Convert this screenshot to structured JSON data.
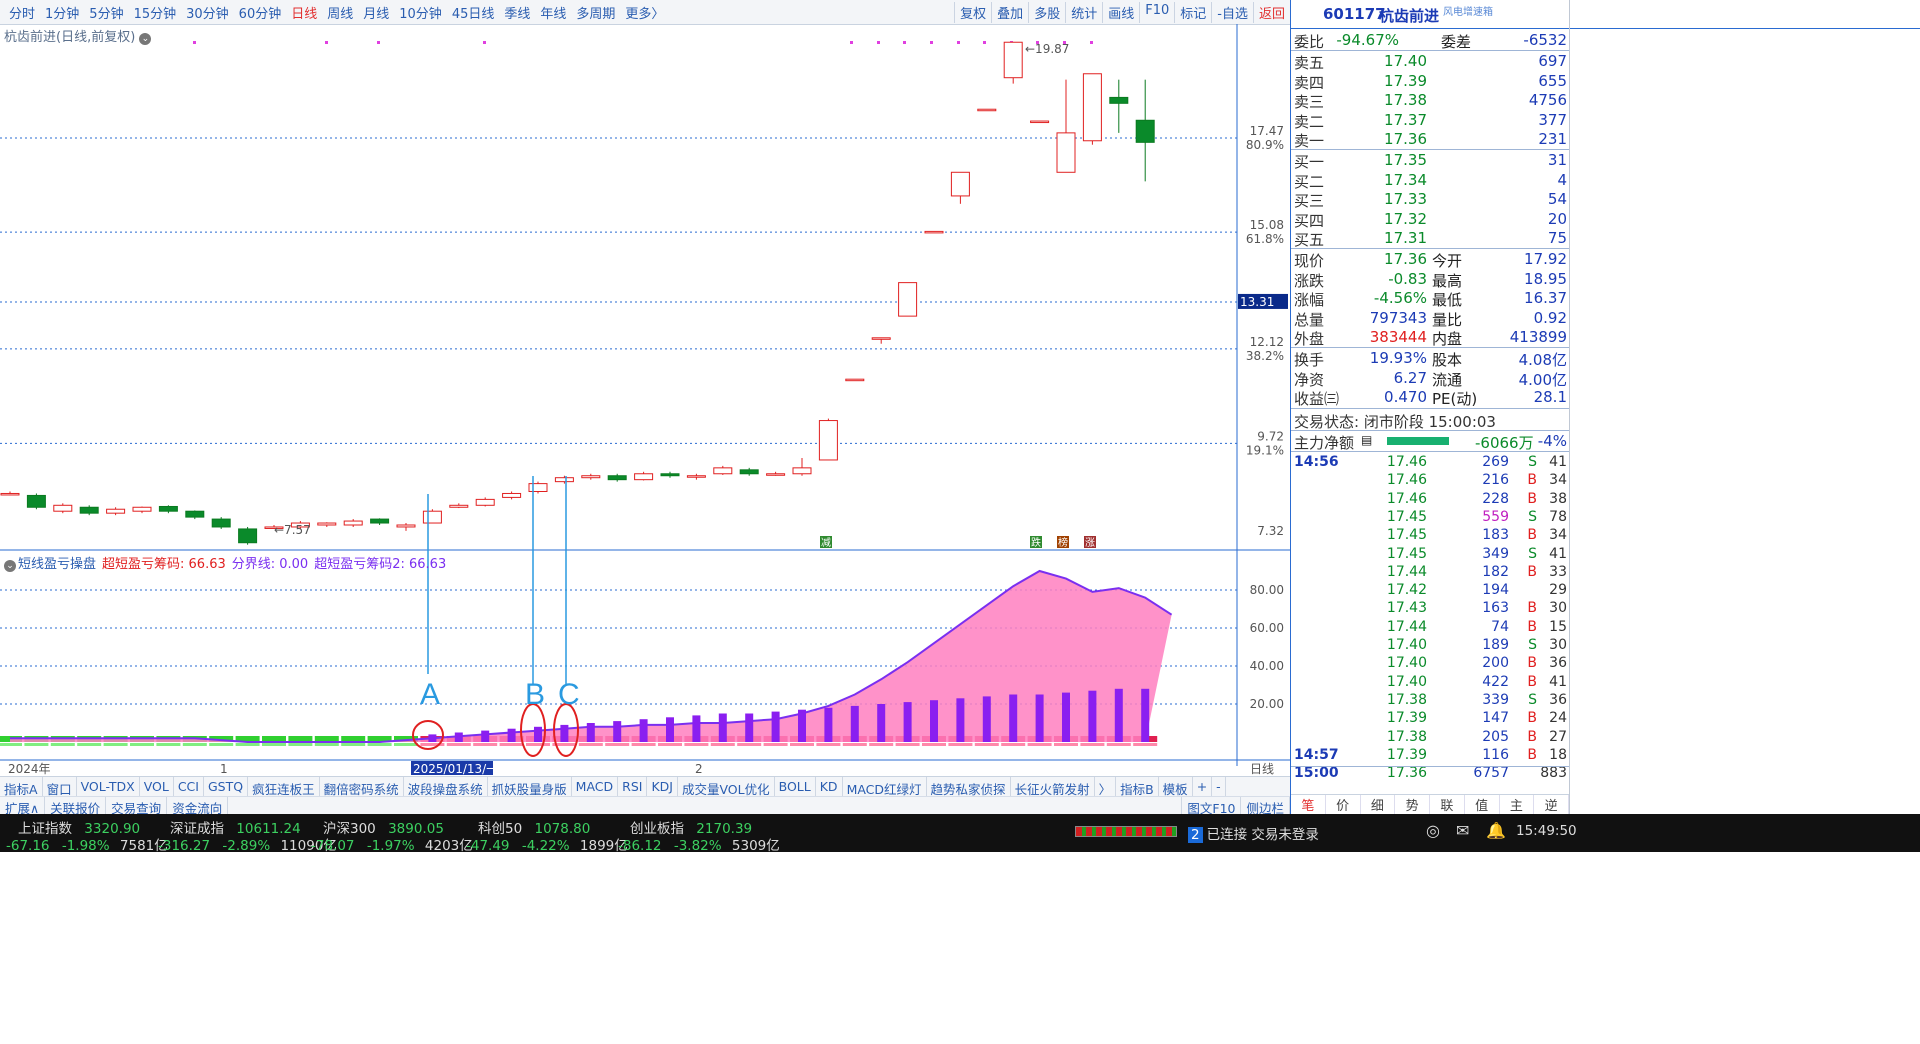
{
  "toolbar": {
    "periods": [
      "分时",
      "1分钟",
      "5分钟",
      "15分钟",
      "30分钟",
      "60分钟",
      "日线",
      "周线",
      "月线",
      "10分钟",
      "45日线",
      "季线",
      "年线",
      "多周期",
      "更多〉"
    ],
    "active_period": "日线",
    "tools": [
      "复权",
      "叠加",
      "多股",
      "统计",
      "画线",
      "F10",
      "标记",
      "-自选",
      "返回"
    ]
  },
  "chart": {
    "title": "杭齿前进(日线,前复权)",
    "price_levels": [
      "17.47",
      "15.08",
      "12.12",
      "9.72",
      "7.32"
    ],
    "pct_levels": [
      "80.9%",
      "61.8%",
      "38.2%",
      "19.1%"
    ],
    "current_marker": "13.31",
    "high_label": "19.87",
    "low_label": "7.57",
    "badges": [
      "减",
      "跌",
      "榜",
      "涨"
    ],
    "date_labels": [
      "2024年",
      "1",
      "2025/01/13/一",
      "2",
      "日线"
    ],
    "annotations": [
      "A",
      "B",
      "C"
    ]
  },
  "indicator": {
    "name": "短线盈亏操盘",
    "line1": "超短盈亏筹码: 66.63",
    "line2": "分界线: 0.00",
    "line3": "超短盈亏筹码2: 66.63",
    "levels": [
      "80.00",
      "60.00",
      "40.00",
      "20.00"
    ]
  },
  "chart_data": {
    "type": "candlestick",
    "title": "杭齿前进(日线,前复权)",
    "candles": [
      {
        "o": 8.45,
        "c": 8.45,
        "h": 8.5,
        "l": 8.4
      },
      {
        "o": 8.4,
        "c": 8.1,
        "h": 8.45,
        "l": 8.05
      },
      {
        "o": 8.0,
        "c": 8.15,
        "h": 8.2,
        "l": 7.95
      },
      {
        "o": 8.1,
        "c": 7.95,
        "h": 8.15,
        "l": 7.9
      },
      {
        "o": 7.95,
        "c": 8.05,
        "h": 8.1,
        "l": 7.9
      },
      {
        "o": 8.0,
        "c": 8.1,
        "h": 8.12,
        "l": 7.95
      },
      {
        "o": 8.12,
        "c": 8.0,
        "h": 8.15,
        "l": 7.95
      },
      {
        "o": 8.0,
        "c": 7.85,
        "h": 8.02,
        "l": 7.8
      },
      {
        "o": 7.8,
        "c": 7.6,
        "h": 7.85,
        "l": 7.55
      },
      {
        "o": 7.55,
        "c": 7.2,
        "h": 7.6,
        "l": 7.15
      },
      {
        "o": 7.6,
        "c": 7.6,
        "h": 7.65,
        "l": 7.57
      },
      {
        "o": 7.6,
        "c": 7.7,
        "h": 7.75,
        "l": 7.55
      },
      {
        "o": 7.65,
        "c": 7.7,
        "h": 7.72,
        "l": 7.6
      },
      {
        "o": 7.65,
        "c": 7.75,
        "h": 7.8,
        "l": 7.6
      },
      {
        "o": 7.8,
        "c": 7.7,
        "h": 7.82,
        "l": 7.65
      },
      {
        "o": 7.6,
        "c": 7.65,
        "h": 7.7,
        "l": 7.5
      },
      {
        "o": 7.7,
        "c": 8.0,
        "h": 8.05,
        "l": 7.7
      },
      {
        "o": 8.1,
        "c": 8.15,
        "h": 8.2,
        "l": 8.08
      },
      {
        "o": 8.15,
        "c": 8.3,
        "h": 8.35,
        "l": 8.12
      },
      {
        "o": 8.35,
        "c": 8.45,
        "h": 8.5,
        "l": 8.3
      },
      {
        "o": 8.5,
        "c": 8.7,
        "h": 8.75,
        "l": 8.45
      },
      {
        "o": 8.75,
        "c": 8.85,
        "h": 8.9,
        "l": 8.7
      },
      {
        "o": 8.85,
        "c": 8.9,
        "h": 8.95,
        "l": 8.8
      },
      {
        "o": 8.9,
        "c": 8.8,
        "h": 8.95,
        "l": 8.75
      },
      {
        "o": 8.8,
        "c": 8.95,
        "h": 9.0,
        "l": 8.78
      },
      {
        "o": 8.95,
        "c": 8.9,
        "h": 9.0,
        "l": 8.85
      },
      {
        "o": 8.9,
        "c": 8.9,
        "h": 8.95,
        "l": 8.8
      },
      {
        "o": 8.95,
        "c": 9.1,
        "h": 9.15,
        "l": 8.92
      },
      {
        "o": 9.05,
        "c": 8.95,
        "h": 9.1,
        "l": 8.9
      },
      {
        "o": 8.95,
        "c": 8.95,
        "h": 9.0,
        "l": 8.9
      },
      {
        "o": 8.95,
        "c": 9.1,
        "h": 9.35,
        "l": 8.9
      },
      {
        "o": 9.3,
        "c": 10.3,
        "h": 10.35,
        "l": 9.3
      },
      {
        "o": 11.35,
        "c": 11.35,
        "h": 11.35,
        "l": 11.35
      },
      {
        "o": 12.4,
        "c": 12.4,
        "h": 12.4,
        "l": 12.25
      },
      {
        "o": 12.95,
        "c": 13.8,
        "h": 13.8,
        "l": 12.95
      },
      {
        "o": 15.1,
        "c": 15.1,
        "h": 15.1,
        "l": 15.1
      },
      {
        "o": 16.0,
        "c": 16.6,
        "h": 16.6,
        "l": 15.8
      },
      {
        "o": 18.2,
        "c": 18.2,
        "h": 18.2,
        "l": 18.2
      },
      {
        "o": 19.0,
        "c": 19.9,
        "h": 19.9,
        "l": 18.85
      },
      {
        "o": 17.9,
        "c": 17.9,
        "h": 17.9,
        "l": 17.9
      },
      {
        "o": 16.6,
        "c": 17.6,
        "h": 18.95,
        "l": 16.6
      },
      {
        "o": 17.4,
        "c": 19.1,
        "h": 19.1,
        "l": 17.3
      },
      {
        "o": 18.5,
        "c": 18.35,
        "h": 18.95,
        "l": 17.6
      },
      {
        "o": 17.92,
        "c": 17.36,
        "h": 18.95,
        "l": 16.37
      }
    ],
    "indicator_area": [
      2,
      2,
      2,
      2,
      2,
      2,
      2,
      2,
      1,
      0,
      0,
      0,
      0,
      0,
      0,
      1,
      2,
      3,
      4,
      5,
      6,
      7,
      8,
      8,
      9,
      9,
      10,
      10,
      11,
      12,
      15,
      19,
      25,
      33,
      42,
      52,
      62,
      72,
      82,
      90,
      86,
      79,
      81,
      76,
      67
    ],
    "indicator_bars": [
      0,
      0,
      0,
      0,
      0,
      0,
      0,
      0,
      0,
      0,
      0,
      0,
      0,
      0,
      0,
      0,
      4,
      5,
      6,
      7,
      8,
      9,
      10,
      11,
      12,
      13,
      14,
      15,
      15,
      16,
      17,
      18,
      19,
      20,
      21,
      22,
      23,
      24,
      25,
      25,
      26,
      27,
      28,
      28
    ]
  },
  "quote": {
    "code": "601177",
    "name": "杭齿前进",
    "tag": "风电增速箱",
    "webi_label": "委比",
    "webi": "-94.67%",
    "weicha_label": "委差",
    "weicha": "-6532",
    "sells": [
      {
        "label": "卖五",
        "price": "17.40",
        "vol": "697"
      },
      {
        "label": "卖四",
        "price": "17.39",
        "vol": "655"
      },
      {
        "label": "卖三",
        "price": "17.38",
        "vol": "4756"
      },
      {
        "label": "卖二",
        "price": "17.37",
        "vol": "377"
      },
      {
        "label": "卖一",
        "price": "17.36",
        "vol": "231"
      }
    ],
    "buys": [
      {
        "label": "买一",
        "price": "17.35",
        "vol": "31"
      },
      {
        "label": "买二",
        "price": "17.34",
        "vol": "4"
      },
      {
        "label": "买三",
        "price": "17.33",
        "vol": "54"
      },
      {
        "label": "买四",
        "price": "17.32",
        "vol": "20"
      },
      {
        "label": "买五",
        "price": "17.31",
        "vol": "75"
      }
    ],
    "stats": [
      {
        "l1": "现价",
        "v1": "17.36",
        "c1": "green",
        "l2": "今开",
        "v2": "17.92",
        "c2": "red"
      },
      {
        "l1": "涨跌",
        "v1": "-0.83",
        "c1": "green",
        "l2": "最高",
        "v2": "18.95",
        "c2": "red"
      },
      {
        "l1": "涨幅",
        "v1": "-4.56%",
        "c1": "green",
        "l2": "最低",
        "v2": "16.37",
        "c2": "green"
      },
      {
        "l1": "总量",
        "v1": "797343",
        "c1": "blue",
        "l2": "量比",
        "v2": "0.92",
        "c2": "green"
      },
      {
        "l1": "外盘",
        "v1": "383444",
        "c1": "red",
        "l2": "内盘",
        "v2": "413899",
        "c2": "green"
      }
    ],
    "stats2": [
      {
        "l1": "换手",
        "v1": "19.93%",
        "l2": "股本",
        "v2": "4.08亿"
      },
      {
        "l1": "净资",
        "v1": "6.27",
        "l2": "流通",
        "v2": "4.00亿"
      },
      {
        "l1": "收益㈢",
        "v1": "0.470",
        "l2": "PE(动)",
        "v2": "28.1"
      }
    ],
    "trade_state": "交易状态: 闭市阶段 15:00:03",
    "main_force_label": "主力净额",
    "main_force_value": "-6066万",
    "main_force_pct": "-4%",
    "ticks": [
      {
        "t": "14:56",
        "p": "17.46",
        "v": "269",
        "s": "S",
        "n": "41"
      },
      {
        "t": "",
        "p": "17.46",
        "v": "216",
        "s": "B",
        "n": "34"
      },
      {
        "t": "",
        "p": "17.46",
        "v": "228",
        "s": "B",
        "n": "38"
      },
      {
        "t": "",
        "p": "17.45",
        "v": "559",
        "s": "S",
        "n": "78"
      },
      {
        "t": "",
        "p": "17.45",
        "v": "183",
        "s": "B",
        "n": "34"
      },
      {
        "t": "",
        "p": "17.45",
        "v": "349",
        "s": "S",
        "n": "41"
      },
      {
        "t": "",
        "p": "17.44",
        "v": "182",
        "s": "B",
        "n": "33"
      },
      {
        "t": "",
        "p": "17.42",
        "v": "194",
        "s": "",
        "n": "29"
      },
      {
        "t": "",
        "p": "17.43",
        "v": "163",
        "s": "B",
        "n": "30"
      },
      {
        "t": "",
        "p": "17.44",
        "v": "74",
        "s": "B",
        "n": "15"
      },
      {
        "t": "",
        "p": "17.40",
        "v": "189",
        "s": "S",
        "n": "30"
      },
      {
        "t": "",
        "p": "17.40",
        "v": "200",
        "s": "B",
        "n": "36"
      },
      {
        "t": "",
        "p": "17.40",
        "v": "422",
        "s": "B",
        "n": "41"
      },
      {
        "t": "",
        "p": "17.38",
        "v": "339",
        "s": "S",
        "n": "36"
      },
      {
        "t": "",
        "p": "17.39",
        "v": "147",
        "s": "B",
        "n": "24"
      },
      {
        "t": "",
        "p": "17.38",
        "v": "205",
        "s": "B",
        "n": "27"
      },
      {
        "t": "14:57",
        "p": "17.39",
        "v": "116",
        "s": "B",
        "n": "18"
      },
      {
        "t": "15:00",
        "p": "17.36",
        "v": "6757",
        "s": "",
        "n": "883"
      }
    ],
    "bottom_tabs": [
      "笔",
      "价",
      "细",
      "势",
      "联",
      "值",
      "主",
      "逆"
    ],
    "f10_label": "图文F10",
    "side_label": "侧边栏"
  },
  "tabs_row1": [
    "指标A",
    "窗口",
    "VOL-TDX",
    "VOL",
    "CCI",
    "GSTQ",
    "疯狂连板王",
    "翻倍密码系统",
    "波段操盘系统",
    "抓妖股量身版",
    "MACD",
    "RSI",
    "KDJ",
    "成交量VOL优化",
    "BOLL",
    "KD",
    "MACD红绿灯",
    "趋势私家侦探",
    "长征火箭发射",
    "〉",
    "指标B",
    "模板",
    "+",
    "-"
  ],
  "tabs_row2": [
    "扩展∧",
    "关联报价",
    "交易查询",
    "资金流向"
  ],
  "status_bar": {
    "indices": [
      {
        "name": "上证指数",
        "val": "3320.90",
        "chg": "-67.16",
        "pct": "-1.98%",
        "amt": "7581亿"
      },
      {
        "name": "深证成指",
        "val": "10611.24",
        "chg": "-316.27",
        "pct": "-2.89%",
        "amt": "11090亿"
      },
      {
        "name": "沪深300",
        "val": "3890.05",
        "chg": "-78.07",
        "pct": "-1.97%",
        "amt": "4203亿"
      },
      {
        "name": "科创50",
        "val": "1078.80",
        "chg": "-47.49",
        "pct": "-4.22%",
        "amt": "1899亿"
      },
      {
        "name": "创业板指",
        "val": "2170.39",
        "chg": "-86.12",
        "pct": "-3.82%",
        "amt": "5309亿"
      }
    ],
    "conn_num": "2",
    "connection": "已连接 交易未登录",
    "time": "15:49:50"
  },
  "colors": {
    "up": "#e02020",
    "down": "#0a8a2a",
    "accent": "#2a6bd1",
    "indicator_fill": "#ff7fc0",
    "indicator_line": "#7a2ff0"
  }
}
